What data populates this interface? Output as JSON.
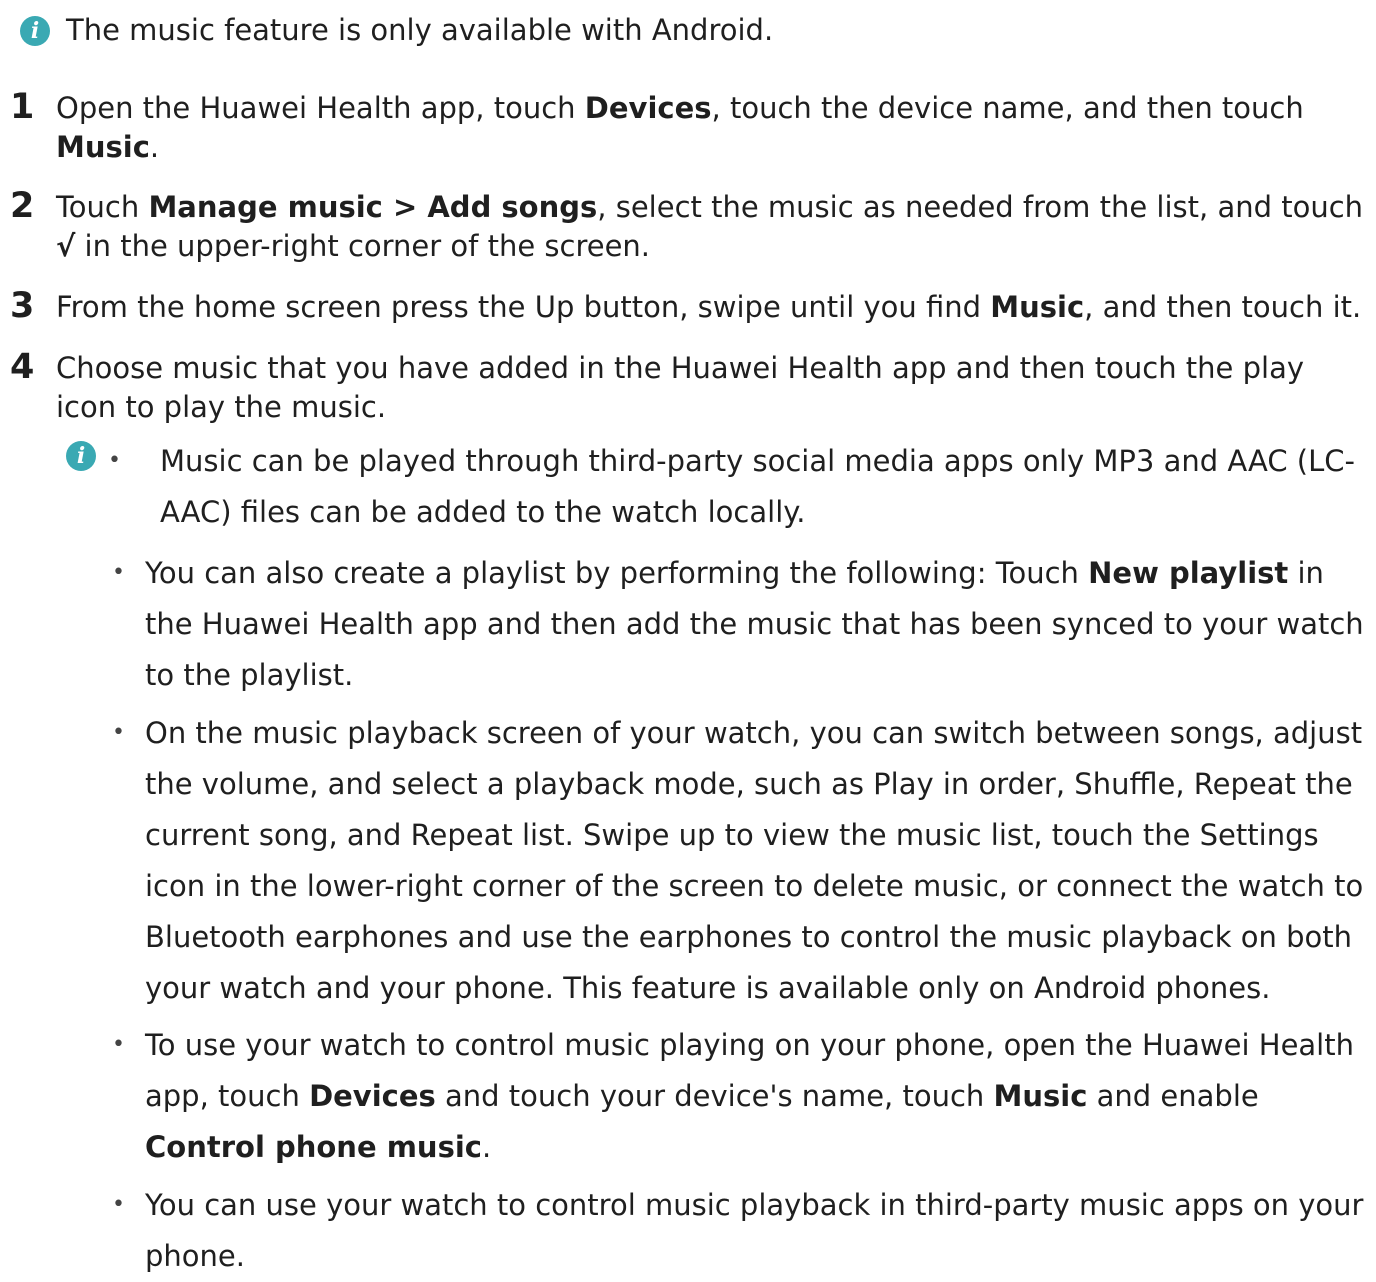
{
  "colors": {
    "info_icon": "#3aa9b3",
    "text": "#1f1f1f"
  },
  "icons": {
    "info": "info-icon"
  },
  "top_note": {
    "glyph": "i",
    "text": "The music feature is only available with Android."
  },
  "steps": [
    {
      "num": "1",
      "parts": [
        "Open the Huawei Health app, touch ",
        "Devices",
        ", touch the device name, and then touch ",
        "Music",
        "."
      ]
    },
    {
      "num": "2",
      "parts": [
        "Touch ",
        "Manage music > Add songs",
        ", select the music as needed from the list, and touch ",
        "√",
        " in the upper-right corner of the screen."
      ]
    },
    {
      "num": "3",
      "parts": [
        "From the home screen press the Up button, swipe until you find ",
        "Music",
        ", and then touch it."
      ]
    },
    {
      "num": "4",
      "parts": [
        "Choose music that you have added in the Huawei Health app and then touch the play icon to play the music."
      ]
    }
  ],
  "notes": {
    "glyph": "i",
    "bullet_char": "•",
    "items": [
      {
        "parts": [
          "Music can be played through third-party social media apps only MP3 and AAC (LC-AAC) files can be added to the watch locally."
        ]
      },
      {
        "parts": [
          "You can also create a playlist by performing the following: Touch ",
          "New playlist",
          " in the Huawei Health app and then add the music that has been synced to your watch to the playlist."
        ]
      },
      {
        "parts": [
          "On the music playback screen of your watch, you can switch between songs, adjust the volume, and select a playback mode, such as Play in order, Shuffle, Repeat the current song, and Repeat list. Swipe up to view the music list, touch the Settings icon in the lower-right corner of the screen to delete music, or connect the watch to Bluetooth earphones and use the earphones to control the music playback on both your watch and your phone. This feature is available only on Android phones."
        ]
      },
      {
        "parts": [
          "To use your watch to control music playing on your phone, open the Huawei Health app, touch ",
          "Devices",
          " and touch your device's name, touch ",
          "Music",
          " and enable ",
          "Control phone music",
          "."
        ]
      },
      {
        "parts": [
          "You can use your watch to control music playback in third-party music apps on your phone."
        ]
      }
    ]
  }
}
